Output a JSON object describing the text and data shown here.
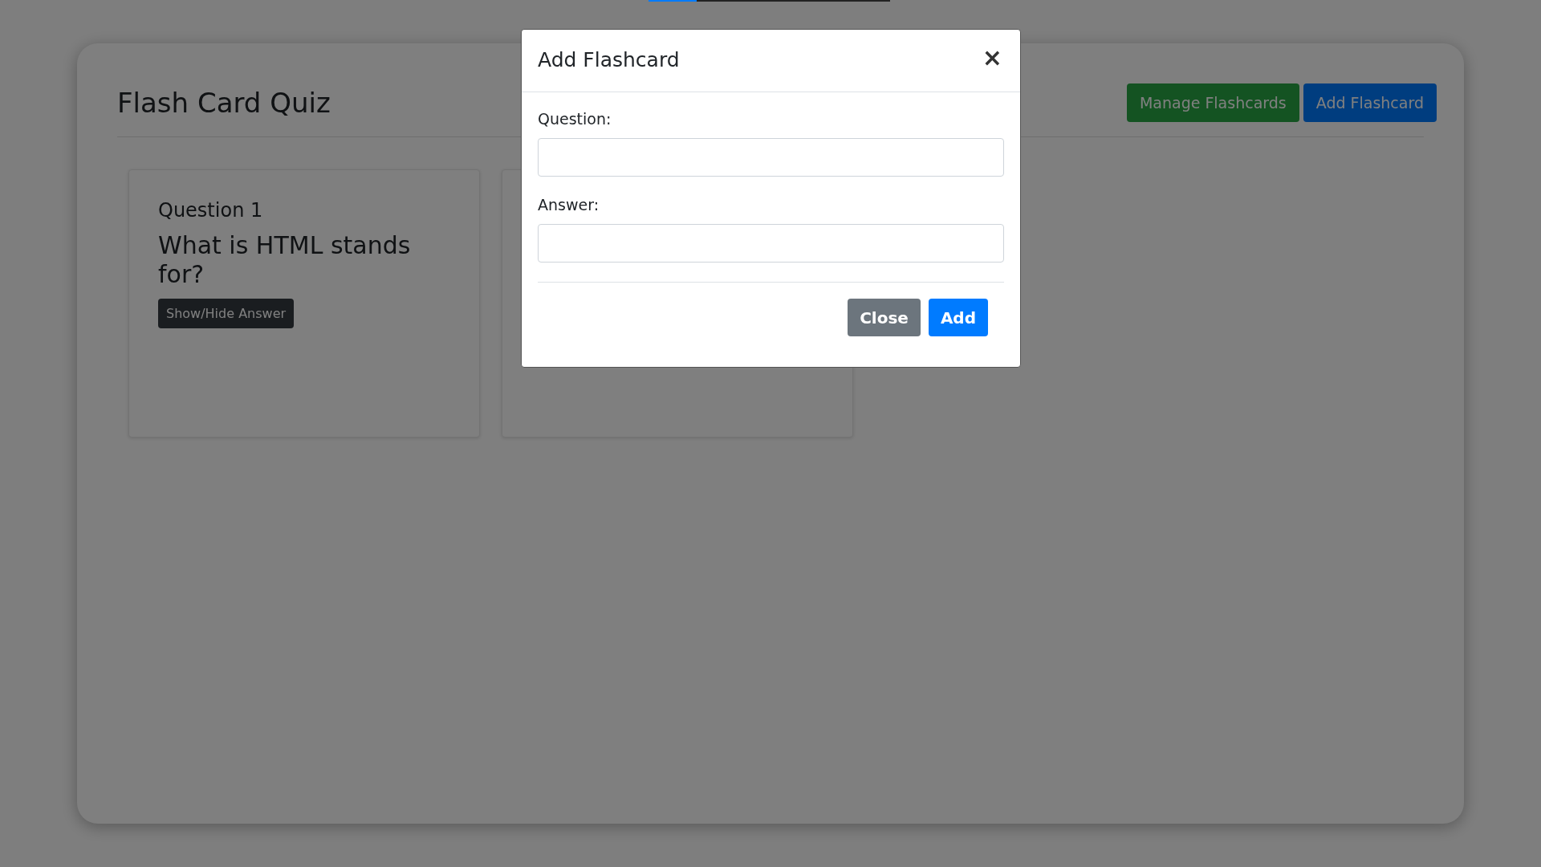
{
  "top_progress": {
    "level": 0.2
  },
  "header": {
    "title": "Flash Card Quiz",
    "buttons": [
      {
        "label": "Manage Flashcards",
        "kind": "success"
      },
      {
        "label": "Add Flashcard",
        "kind": "primary"
      }
    ]
  },
  "cards": [
    {
      "kind": "question",
      "number": "Question 1",
      "question": "What is HTML stands for?",
      "button": "Show/Hide Answer"
    },
    {
      "kind": "covered"
    }
  ],
  "modal": {
    "title": "Add Flashcard",
    "close_icon": "×",
    "fields": [
      {
        "label": "Question:"
      },
      {
        "label": "Answer:"
      }
    ],
    "buttons": [
      {
        "label": "Close",
        "kind": "secondary"
      },
      {
        "label": "Add",
        "kind": "primary"
      }
    ]
  }
}
